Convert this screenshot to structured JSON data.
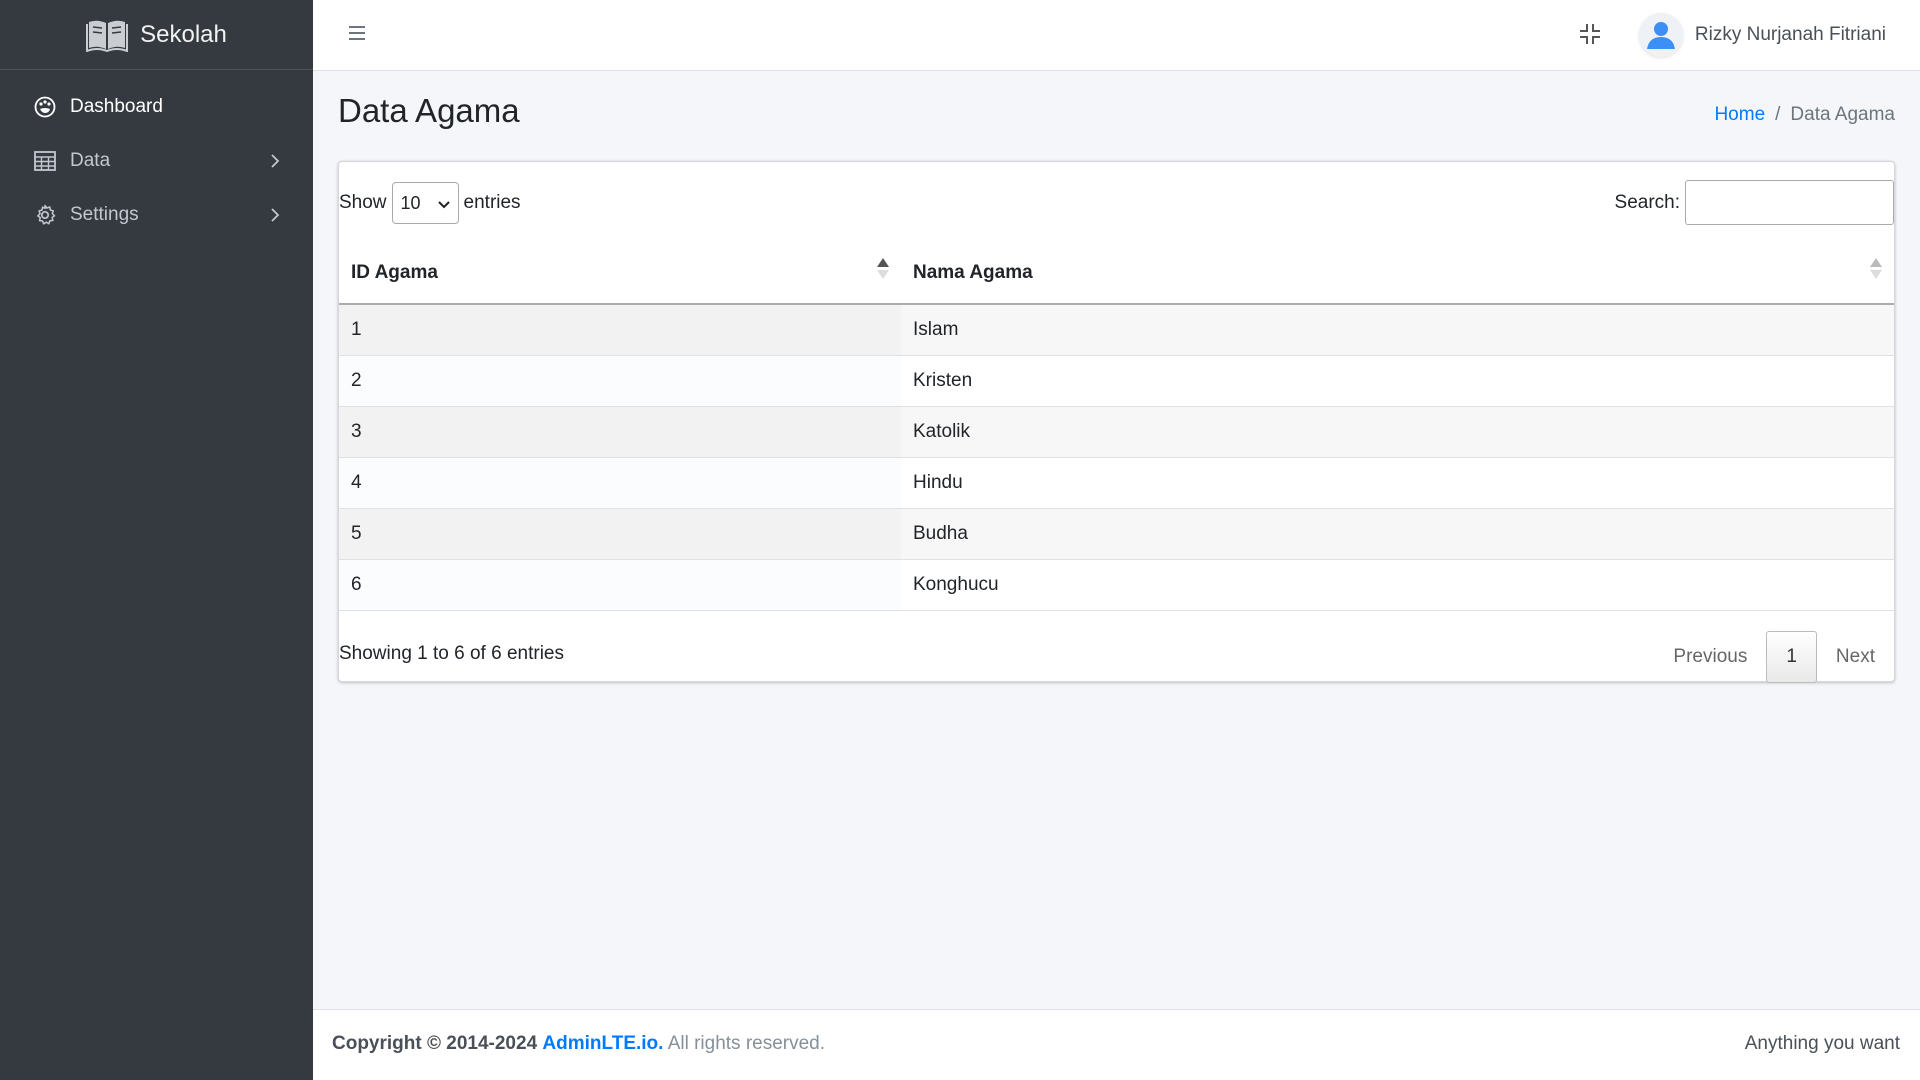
{
  "brand": {
    "name": "Sekolah",
    "icon": "book-open-icon"
  },
  "sidebar": {
    "items": [
      {
        "label": "Dashboard",
        "icon": "palette-icon",
        "active": true,
        "has_children": false
      },
      {
        "label": "Data",
        "icon": "table-icon",
        "active": false,
        "has_children": true
      },
      {
        "label": "Settings",
        "icon": "gear-icon",
        "active": false,
        "has_children": true
      }
    ]
  },
  "header": {
    "menu_icon": "hamburger-icon",
    "fullscreen_icon": "compress-icon",
    "user": {
      "name": "Rizky Nurjanah Fitriani",
      "avatar_icon": "user-avatar-icon"
    }
  },
  "page": {
    "title": "Data Agama",
    "breadcrumb": {
      "home": "Home",
      "separator": "/",
      "current": "Data Agama"
    }
  },
  "datatable": {
    "length": {
      "show": "Show",
      "value": "10",
      "entries": "entries"
    },
    "search": {
      "label": "Search:",
      "value": ""
    },
    "columns": [
      "ID Agama",
      "Nama Agama"
    ],
    "rows": [
      [
        "1",
        "Islam"
      ],
      [
        "2",
        "Kristen"
      ],
      [
        "3",
        "Katolik"
      ],
      [
        "4",
        "Hindu"
      ],
      [
        "5",
        "Budha"
      ],
      [
        "6",
        "Konghucu"
      ]
    ],
    "info": "Showing 1 to 6 of 6 entries",
    "pagination": {
      "previous": "Previous",
      "current": "1",
      "next": "Next"
    }
  },
  "footer": {
    "copyright": "Copyright © 2014-2024",
    "link": "AdminLTE.io.",
    "rights": "All rights reserved.",
    "right_text": "Anything you want"
  },
  "colors": {
    "sidebar_bg": "#343a40",
    "accent": "#007bff",
    "page_bg": "#f4f6f9"
  }
}
